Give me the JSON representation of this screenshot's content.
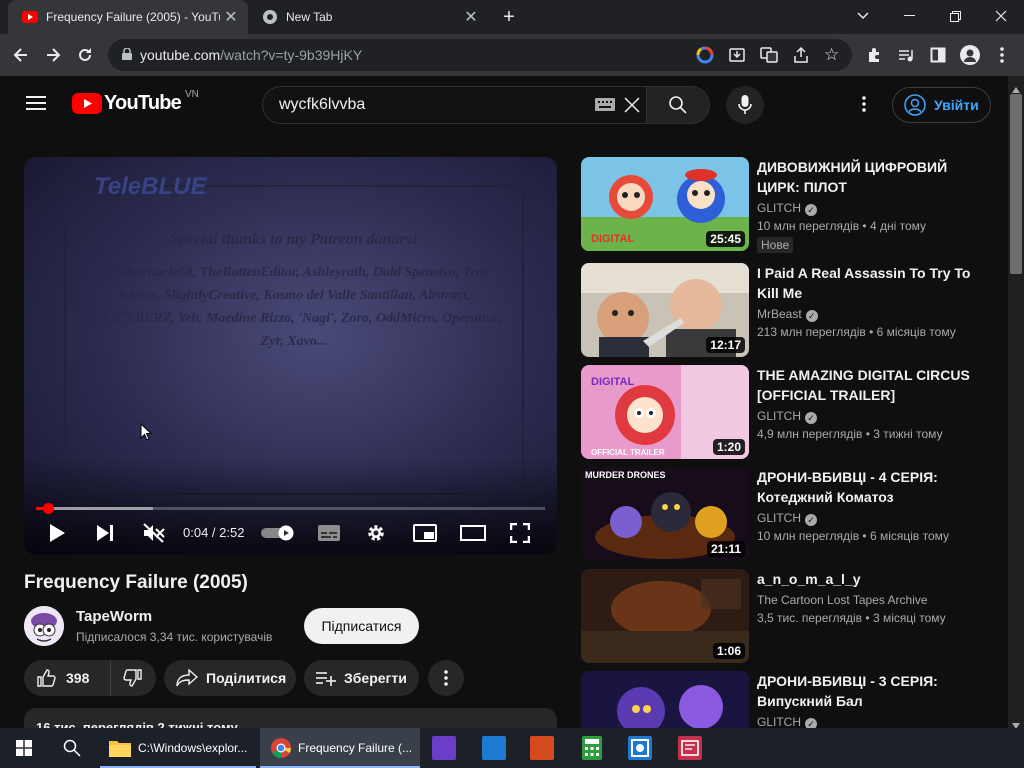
{
  "browser": {
    "tabs": [
      {
        "title": "Frequency Failure (2005) - YouTube",
        "active": true
      },
      {
        "title": "New Tab",
        "active": false
      }
    ],
    "new_tab_symbol": "+",
    "url_host": "youtube.com",
    "url_path": "/watch?v=ty-9b39HjKY"
  },
  "youtube": {
    "logo_text": "YouTube",
    "region": "VN",
    "search_value": "wycfk6lvvba",
    "signin_label": "Увійти"
  },
  "player": {
    "time": "0:04 / 2:52",
    "progress_fraction": 0.023,
    "buffer_fraction": 0.23,
    "credits_logo": "TeleBLUE",
    "credits_heading": "Special thanks to my Patreon donors!",
    "credits_names": "UglyBarnacle58, TheRottenEditor, Ashleyrath, Dold Spenstvo, Troy Adams, SlightlyCreative, Kosmo del Valle Santillan, Abstract, DOGCYBERZ, Yeh, Maedine Rizzo, 'Nagi', Zoro, OddMicro, Operative, Zyr, Xavo..."
  },
  "video": {
    "title": "Frequency Failure (2005)",
    "channel": "TapeWorm",
    "subscribers": "Підписалося 3,34 тис. користувачів",
    "subscribe_label": "Підписатися",
    "likes": "398",
    "share_label": "Поділитися",
    "save_label": "Зберегти",
    "description_preview": "16 тис. переглядів  2 тижні тому"
  },
  "recommendations": [
    {
      "title": "ДИВОВИЖНИЙ ЦИФРОВИЙ ЦИРК: ПІЛОТ",
      "channel": "GLITCH",
      "verified": true,
      "views": "10 млн переглядів",
      "age": "4 дні тому",
      "duration": "25:45",
      "badge": "Нове"
    },
    {
      "title": "I Paid A Real Assassin To Try To Kill Me",
      "channel": "MrBeast",
      "verified": true,
      "views": "213 млн переглядів",
      "age": "6 місяців тому",
      "duration": "12:17",
      "badge": ""
    },
    {
      "title": "THE AMAZING DIGITAL CIRCUS [OFFICIAL TRAILER]",
      "channel": "GLITCH",
      "verified": true,
      "views": "4,9 млн переглядів",
      "age": "3 тижні тому",
      "duration": "1:20",
      "badge": ""
    },
    {
      "title": "ДРОНИ-ВБИВЦІ - 4 СЕРІЯ: Котеджний Коматоз",
      "channel": "GLITCH",
      "verified": true,
      "views": "10 млн переглядів",
      "age": "6 місяців тому",
      "duration": "21:11",
      "badge": ""
    },
    {
      "title": "a_n_o_m_a_l_y",
      "channel": "The Cartoon Lost Tapes Archive",
      "verified": false,
      "views": "3,5 тис. переглядів",
      "age": "3 місяці тому",
      "duration": "1:06",
      "badge": ""
    },
    {
      "title": "ДРОНИ-ВБИВЦІ - 3 СЕРІЯ: Випускний Бал",
      "channel": "GLITCH",
      "verified": true,
      "views": "",
      "age": "",
      "duration": "",
      "badge": ""
    }
  ],
  "taskbar": {
    "items": [
      {
        "label": "C:\\Windows\\explor...",
        "icon": "folder-icon"
      },
      {
        "label": "Frequency Failure (...",
        "icon": "chrome-icon"
      }
    ]
  },
  "colors": {
    "accent_red": "#ff0000",
    "link_blue": "#3ea6ff",
    "background": "#0f0f0f"
  }
}
